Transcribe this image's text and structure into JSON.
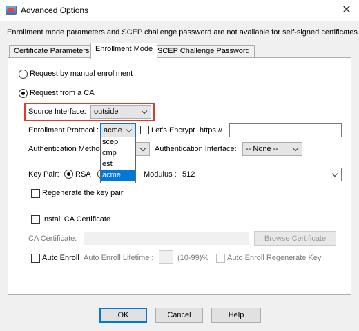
{
  "window": {
    "title": "Advanced Options",
    "close_glyph": "✕"
  },
  "intro_text": "Enrollment mode parameters and SCEP challenge password are not available for self-signed certificates.",
  "tabs": [
    {
      "label": "Certificate Parameters",
      "active": false
    },
    {
      "label": "Enrollment Mode",
      "active": true
    },
    {
      "label": "SCEP Challenge Password",
      "active": false
    }
  ],
  "enrollment": {
    "manual_label": "Request by manual enrollment",
    "manual_selected": false,
    "ca_label": "Request from a CA",
    "ca_selected": true
  },
  "source_interface": {
    "label": "Source Interface:",
    "value": "outside"
  },
  "protocol": {
    "label": "Enrollment Protocol :",
    "value": "acme",
    "options": [
      "scep",
      "cmp",
      "est",
      "acme"
    ],
    "selected_index": 3,
    "dropdown_open": true
  },
  "lets_encrypt": {
    "label": "Let's Encrypt",
    "checked": false
  },
  "url": {
    "prefix": "https://",
    "value": ""
  },
  "auth_method": {
    "label": "Authentication Method"
  },
  "auth_interface": {
    "label": "Authentication Interface:",
    "value": "-- None --"
  },
  "key_pair": {
    "label": "Key Pair:",
    "rsa_label": "RSA",
    "rsa_selected": true,
    "modulus_label": "Modulus :",
    "modulus_value": "512"
  },
  "regenerate": {
    "label": "Regenerate the key pair",
    "checked": false
  },
  "install_ca": {
    "label": "Install CA Certificate",
    "checked": false
  },
  "ca_certificate": {
    "label": "CA Certificate:",
    "value": "",
    "browse_label": "Browse Certificate"
  },
  "auto_enroll": {
    "label": "Auto Enroll",
    "checked": false,
    "lifetime_label": "Auto Enroll Lifetime :",
    "lifetime_value": "",
    "range_label": "(10-99)%",
    "regenerate_label": "Auto Enroll Regenerate Key",
    "regenerate_checked": false
  },
  "buttons": {
    "ok": "OK",
    "cancel": "Cancel",
    "help": "Help"
  },
  "colors": {
    "highlight_border": "#e03a2e",
    "selection": "#0078d7"
  }
}
